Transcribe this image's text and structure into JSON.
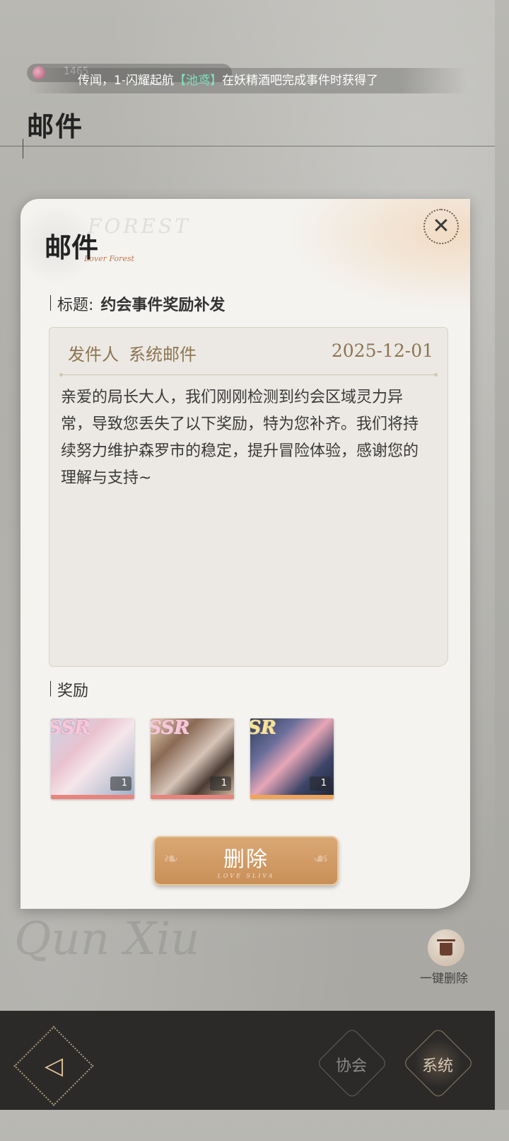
{
  "header": {
    "currency_value": "1465",
    "ticker_prefix": "传闻，1-闪耀起航",
    "ticker_highlight": "【池鸢】",
    "ticker_suffix": "在妖精酒吧完成事件时获得了",
    "page_title": "邮件"
  },
  "modal": {
    "title": "邮件",
    "watermark": "FOREST",
    "script": "Lover Forest",
    "close_icon": "close-icon",
    "subject_label": "标题:",
    "subject_value": "约会事件奖励补发",
    "sender_label": "发件人",
    "sender_name": "系统邮件",
    "date": "2025-12-01",
    "body": "亲爱的局长大人，我们刚刚检测到约会区域灵力异常，导致您丢失了以下奖励，特为您补齐。我们将持续努力维护森罗市的稳定，提升冒险体验，感谢您的理解与支持~",
    "rewards_label": "奖励",
    "rewards": [
      {
        "rarity": "SSR",
        "qty": "1",
        "bar_color": "#e8847d"
      },
      {
        "rarity": "SSR",
        "qty": "1",
        "bar_color": "#e8847d"
      },
      {
        "rarity": "SR",
        "qty": "1",
        "bar_color": "#f0a45a"
      }
    ],
    "delete_label": "删除",
    "delete_sub": "LOVE SLIVA"
  },
  "side": {
    "trash_icon": "trash-icon",
    "delete_all_label": "一键删除",
    "bg_script": "Qun Xiu"
  },
  "nav": {
    "back_icon": "back-arrow-icon",
    "association": "协会",
    "system": "系统"
  },
  "colors": {
    "accent": "#c98f58",
    "text_brown": "#8d7552",
    "highlight": "#7fe0c0"
  }
}
